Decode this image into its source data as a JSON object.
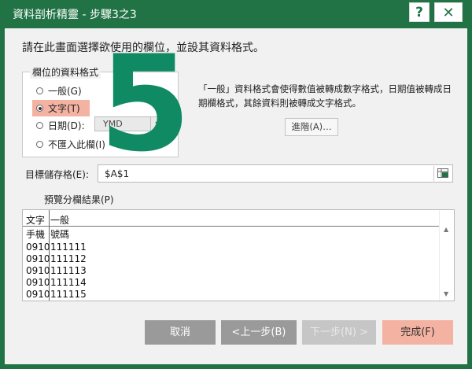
{
  "window": {
    "title": "資料剖析精靈 - 步驟3之3",
    "help_label": "?",
    "close_label": "✕"
  },
  "instruction": "請在此畫面選擇欲使用的欄位，並設其資料格式。",
  "column_format": {
    "legend": "欄位的資料格式",
    "options": [
      {
        "label": "一般(G)",
        "checked": false
      },
      {
        "label": "文字(T)",
        "checked": true
      },
      {
        "label": "日期(D):",
        "checked": false
      },
      {
        "label": "不匯入此欄(I)",
        "checked": false
      }
    ],
    "date_format_value": "YMD"
  },
  "overlay_number": "5",
  "description": "「一般」資料格式會使得數值被轉成數字格式，日期值被轉成日期欄格式，其餘資料則被轉成文字格式。",
  "advanced_button": "進階(A)…",
  "destination": {
    "label": "目標儲存格(E):",
    "value": "$A$1"
  },
  "preview": {
    "label": "預覽分欄結果(P)",
    "header": [
      "文字",
      "一般"
    ],
    "rows": [
      [
        "手機",
        "號碼"
      ],
      [
        "0910",
        "111111"
      ],
      [
        "0910",
        "111112"
      ],
      [
        "0910",
        "111113"
      ],
      [
        "0910",
        "111114"
      ],
      [
        "0910",
        "111115"
      ]
    ]
  },
  "buttons": {
    "cancel": "取消",
    "back": "<上一步(B)",
    "next": "下一步(N) >",
    "finish": "完成(F)"
  },
  "colors": {
    "title_bar": "#217346",
    "highlight": "#f4b2a2",
    "overlay_number": "#0f8a63"
  }
}
